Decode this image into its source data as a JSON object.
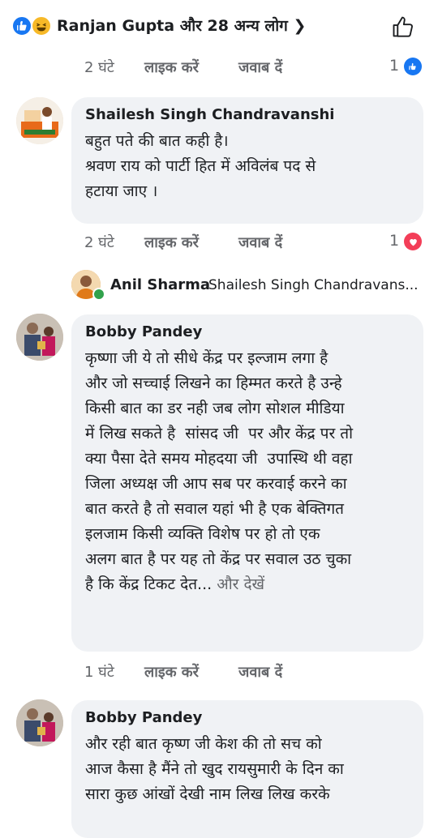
{
  "reactions_summary": {
    "text": "Ranjan Gupta और 28 अन्य लोग ❯"
  },
  "post_meta": {
    "time": "2 घंटे",
    "like": "लाइक करें",
    "reply": "जवाब दें",
    "count": "1"
  },
  "comments": [
    {
      "author": "Shailesh Singh Chandravanshi",
      "text": "बहुत पते की बात कही है।\nश्रवण राय को पार्टी हित में अविलंब पद से\nहटाया जाए ।",
      "time": "2 घंटे",
      "like": "लाइक करें",
      "reply": "जवाब दें",
      "reaction_count": "1"
    },
    {
      "reply_author": "Anil Sharma",
      "reply_preview": "Shailesh Singh Chandravans..."
    },
    {
      "author": "Bobby Pandey",
      "text": "कृष्णा जी ये तो सीधे केंद्र पर इल्जाम लगा है\nऔर जो सच्चाई लिखने का हिम्मत करते है उन्हे\nकिसी बात का डर नही जब लोग सोशल मीडिया\nमें लिख सकते है  सांसद जी  पर और केंद्र पर तो\nक्या पैसा देते समय मोहदया जी  उपास्थि थी वहा\nजिला अध्यक्ष जी आप सब पर करवाई करने का\nबात करते है तो सवाल यहां भी है एक बेक्तिगत\nइलजाम किसी व्यक्ति विशेष पर हो तो एक\nअलग बात है पर यह तो केंद्र पर सवाल उठ चुका\nहै कि केंद्र टिकट देत...",
      "see_more": " और देखें",
      "time": "1 घंटे",
      "like": "लाइक करें",
      "reply": "जवाब दें"
    },
    {
      "author": "Bobby Pandey",
      "text": "और रही बात कृष्ण जी केश की तो सच को\nआज कैसा है मैंने तो खुद रायसुमारी के दिन का\nसारा कुछ आंखों देखी नाम लिख लिख करके"
    }
  ],
  "colors": {
    "blue": "#1877f2",
    "red": "#f33e58",
    "gray": "#65676b",
    "bubble": "#f0f2f5",
    "online": "#31a24c"
  }
}
